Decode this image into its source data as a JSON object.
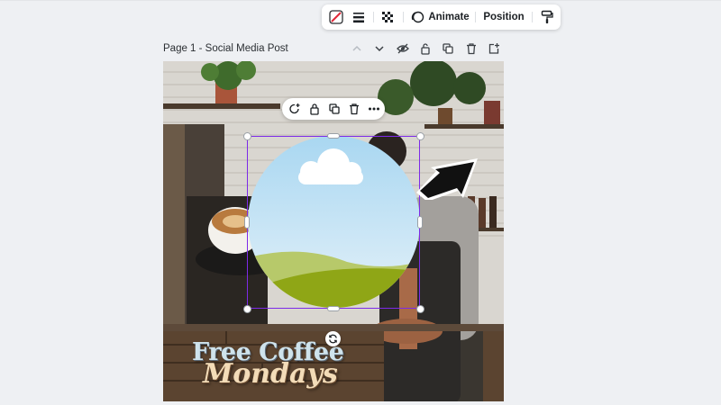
{
  "toolbar": {
    "items": [
      {
        "name": "color-none",
        "icon": "no-color-icon"
      },
      {
        "name": "border-style",
        "icon": "border-lines-icon"
      },
      {
        "name": "transparency",
        "icon": "checkerboard-icon"
      }
    ],
    "animate_label": "Animate",
    "position_label": "Position",
    "copy_style_icon": "paint-roller-icon"
  },
  "page": {
    "title": "Page 1 - Social Media Post",
    "tools": [
      "chevron-up-icon",
      "chevron-down-icon",
      "hide-icon",
      "lock-icon",
      "duplicate-icon",
      "trash-icon",
      "add-page-icon"
    ]
  },
  "design": {
    "headline": "Free Coffee",
    "subline": "Mondays"
  },
  "element_menu": {
    "items": [
      "comment-icon",
      "lock-icon",
      "duplicate-icon",
      "trash-icon",
      "more-icon"
    ]
  },
  "colors": {
    "selection": "#7d2ae8",
    "sky_top": "#a9d7f1",
    "grass": "#8fa616"
  }
}
